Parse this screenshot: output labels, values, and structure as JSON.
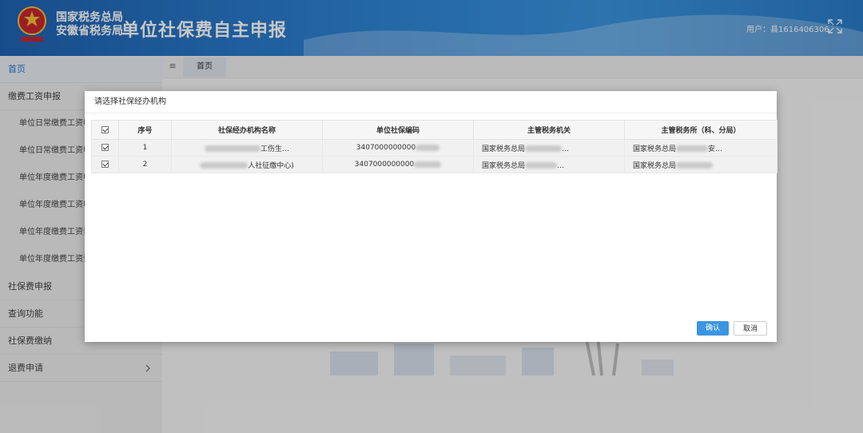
{
  "header": {
    "org_line1": "国家税务总局",
    "org_line2": "安徽省税务局",
    "app_title": "单位社保费自主申报",
    "user_label": "用户：",
    "user_id": "县1616406306"
  },
  "sidebar": {
    "items": [
      {
        "label": "首页"
      },
      {
        "label": "缴费工资申报"
      },
      {
        "label": "单位日常缴费工资申"
      },
      {
        "label": "单位日常缴费工资申"
      },
      {
        "label": "单位年度缴费工资申"
      },
      {
        "label": "单位年度缴费工资申"
      },
      {
        "label": "单位年度缴费工资调"
      },
      {
        "label": "单位年度缴费工资调"
      },
      {
        "label": "社保费申报"
      },
      {
        "label": "查询功能"
      },
      {
        "label": "社保费缴纳"
      },
      {
        "label": "退费申请"
      }
    ]
  },
  "tabs": {
    "menu_icon": "≡",
    "home": "首页"
  },
  "dialog": {
    "title": "请选择社保经办机构",
    "columns": [
      "序号",
      "社保经办机构名称",
      "单位社保编码",
      "主管税务机关",
      "主管税务所（科、分局）"
    ],
    "rows": [
      {
        "index": "1",
        "name": "工伤生…",
        "code": "3407000000000",
        "authority": "国家税务总局",
        "office": "国家税务总局",
        "office_tail": "安…",
        "authority_tail": "…"
      },
      {
        "index": "2",
        "name": "人社征缴中心)",
        "code": "3407000000000",
        "authority": "国家税务总局",
        "office": "国家税务总局",
        "office_tail": "",
        "authority_tail": "…"
      }
    ],
    "confirm": "确认",
    "cancel": "取消"
  },
  "colors": {
    "primary": "#3c95e0",
    "header": "#2a7cc9"
  }
}
